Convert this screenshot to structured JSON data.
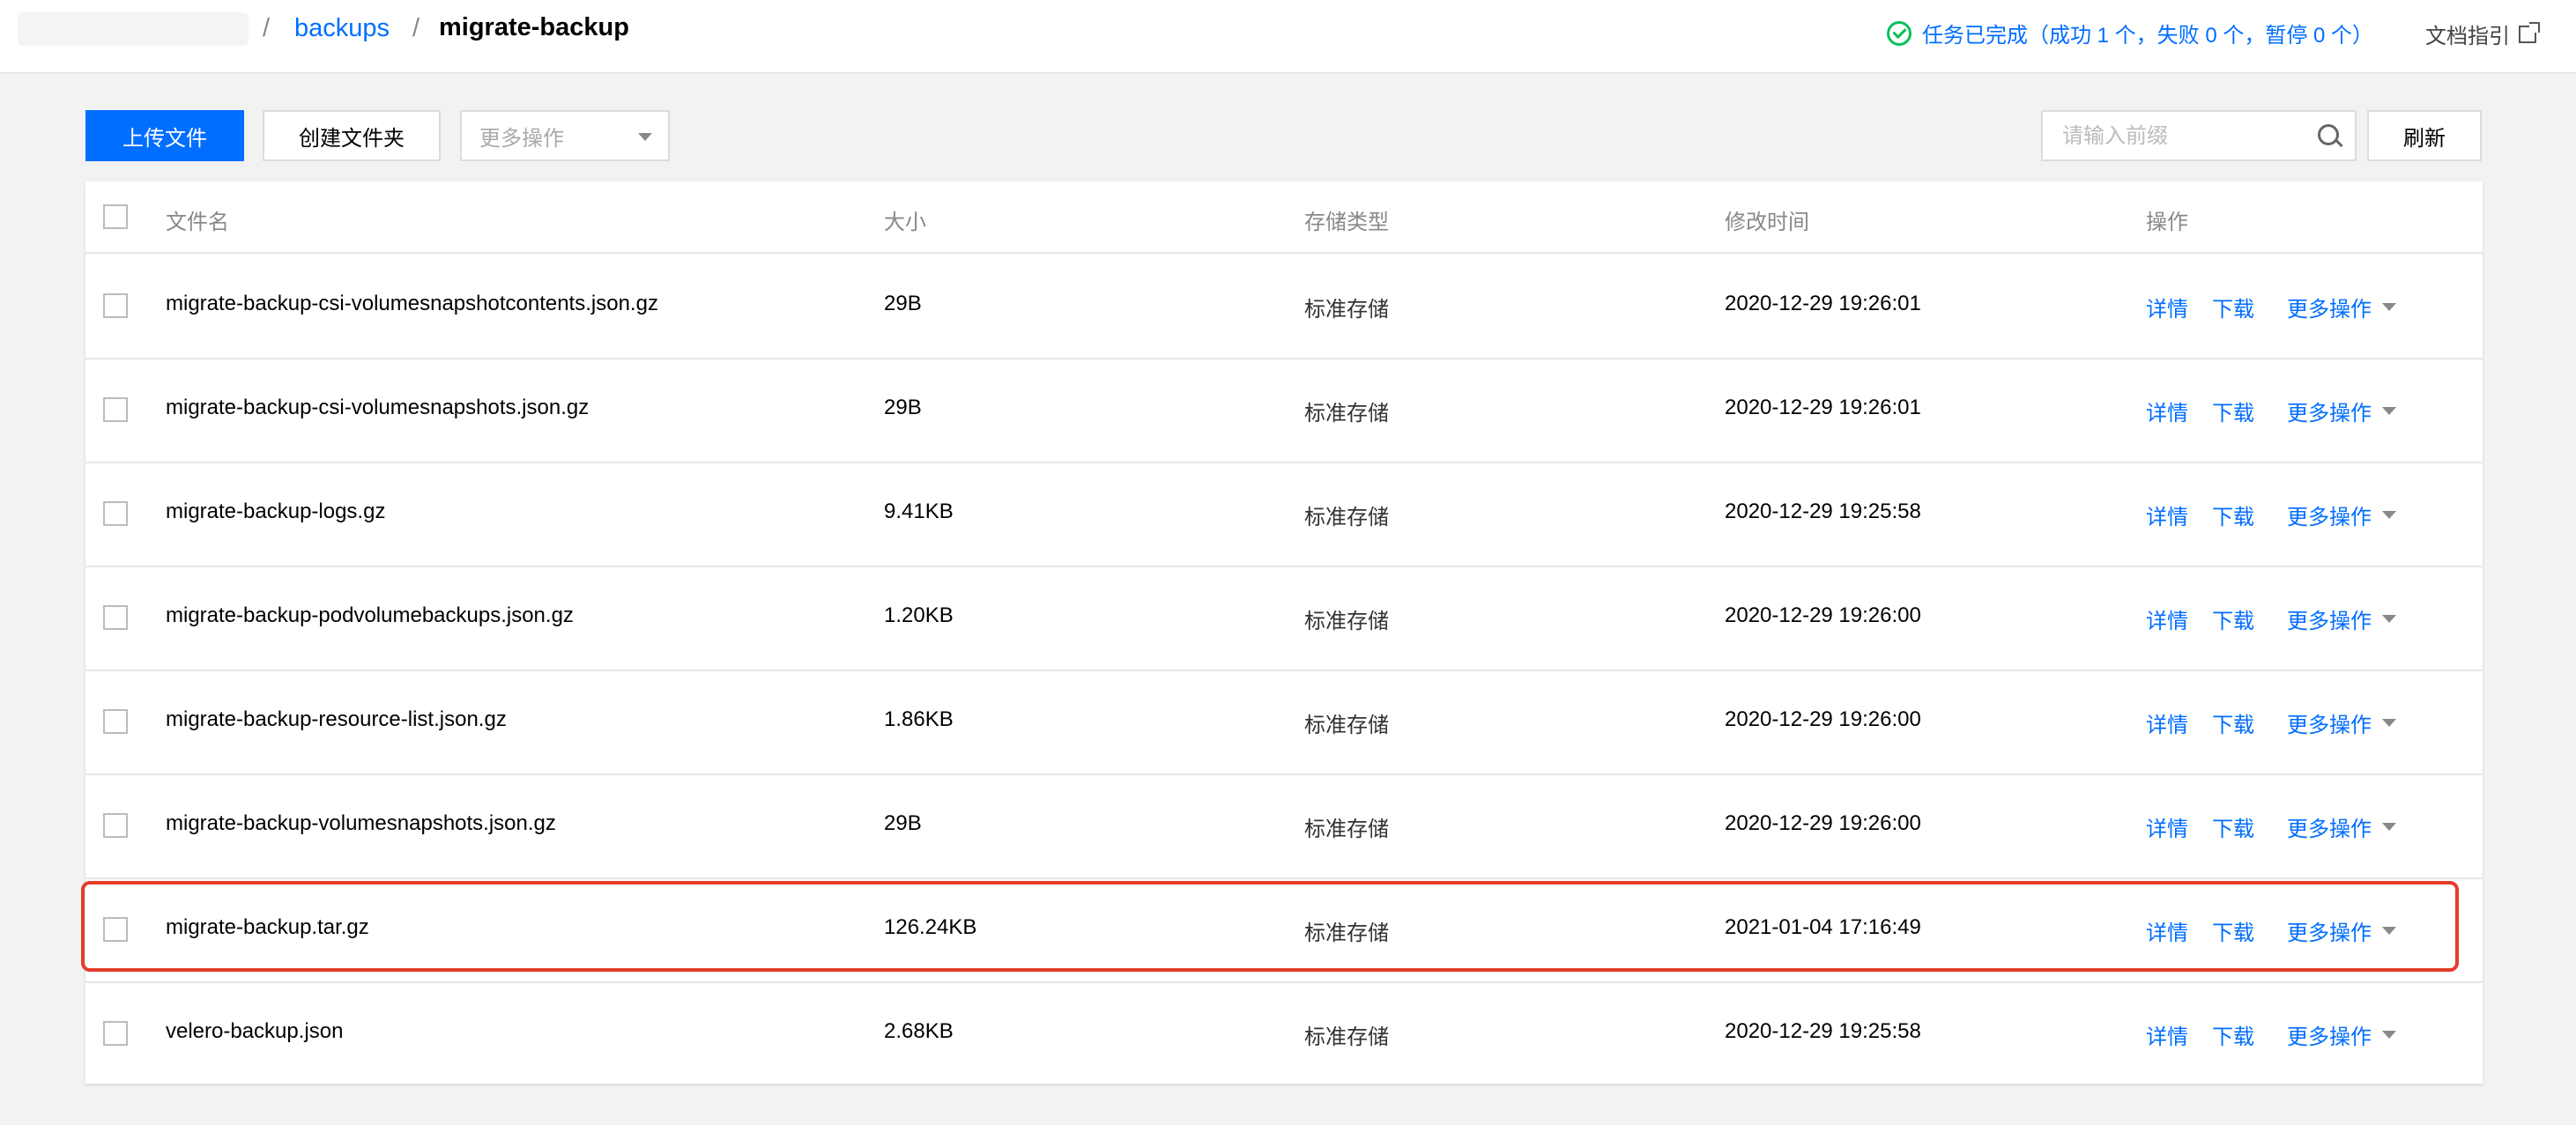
{
  "breadcrumb": {
    "separator": "/",
    "parent": "backups",
    "current": "migrate-backup"
  },
  "task_status": {
    "icon": "check-circle-icon",
    "text": "任务已完成（成功 1 个，失败 0 个，暂停 0 个）",
    "color": "#0abf5b"
  },
  "doc_guide": {
    "label": "文档指引",
    "icon": "external-link-icon"
  },
  "toolbar": {
    "upload_label": "上传文件",
    "mkdir_label": "创建文件夹",
    "more_placeholder": "更多操作",
    "search_placeholder": "请输入前缀",
    "refresh_label": "刷新"
  },
  "table": {
    "columns": [
      "文件名",
      "大小",
      "存储类型",
      "修改时间",
      "操作"
    ],
    "actions": {
      "detail": "详情",
      "download": "下载",
      "more": "更多操作"
    },
    "rows": [
      {
        "name": "migrate-backup-csi-volumesnapshotcontents.json.gz",
        "size": "29B",
        "storage": "标准存储",
        "modified": "2020-12-29 19:26:01"
      },
      {
        "name": "migrate-backup-csi-volumesnapshots.json.gz",
        "size": "29B",
        "storage": "标准存储",
        "modified": "2020-12-29 19:26:01"
      },
      {
        "name": "migrate-backup-logs.gz",
        "size": "9.41KB",
        "storage": "标准存储",
        "modified": "2020-12-29 19:25:58"
      },
      {
        "name": "migrate-backup-podvolumebackups.json.gz",
        "size": "1.20KB",
        "storage": "标准存储",
        "modified": "2020-12-29 19:26:00"
      },
      {
        "name": "migrate-backup-resource-list.json.gz",
        "size": "1.86KB",
        "storage": "标准存储",
        "modified": "2020-12-29 19:26:00"
      },
      {
        "name": "migrate-backup-volumesnapshots.json.gz",
        "size": "29B",
        "storage": "标准存储",
        "modified": "2020-12-29 19:26:00"
      },
      {
        "name": "migrate-backup.tar.gz",
        "size": "126.24KB",
        "storage": "标准存储",
        "modified": "2021-01-04 17:16:49",
        "highlighted": true
      },
      {
        "name": "velero-backup.json",
        "size": "2.68KB",
        "storage": "标准存储",
        "modified": "2020-12-29 19:25:58"
      }
    ]
  },
  "colors": {
    "accent": "#006eff",
    "highlight": "#e53c2a",
    "success": "#0abf5b"
  }
}
